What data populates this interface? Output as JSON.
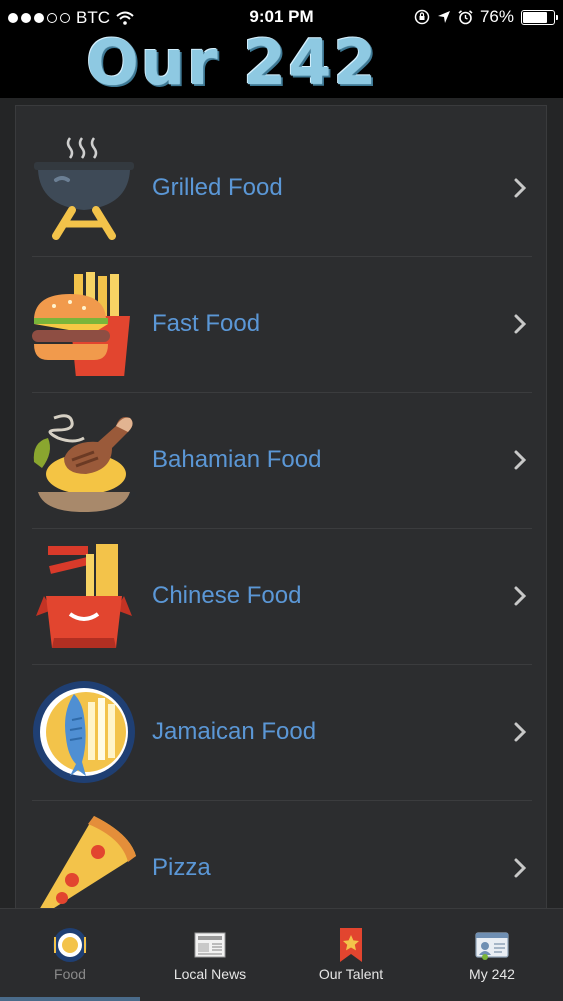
{
  "status_bar": {
    "carrier": "BTC",
    "time": "9:01 PM",
    "battery": "76%",
    "battery_level": 0.76,
    "signal_dots_filled": 3,
    "signal_dots_total": 5
  },
  "header": {
    "logo_text": "Our 242"
  },
  "colors": {
    "accent": "#5b97d6",
    "background": "#242526",
    "panel": "#2c2d2f"
  },
  "categories": [
    {
      "label": "Grilled Food",
      "icon": "grill-icon"
    },
    {
      "label": "Fast Food",
      "icon": "burger-fries-icon"
    },
    {
      "label": "Bahamian Food",
      "icon": "chicken-leg-icon"
    },
    {
      "label": "Chinese Food",
      "icon": "takeout-box-icon"
    },
    {
      "label": "Jamaican Food",
      "icon": "fish-plate-icon"
    },
    {
      "label": "Pizza",
      "icon": "pizza-slice-icon"
    }
  ],
  "tabs": [
    {
      "label": "Food",
      "icon": "food-plate-icon",
      "active": true
    },
    {
      "label": "Local News",
      "icon": "newspaper-icon",
      "active": false
    },
    {
      "label": "Our Talent",
      "icon": "star-ribbon-icon",
      "active": false
    },
    {
      "label": "My 242",
      "icon": "id-card-icon",
      "active": false
    }
  ]
}
